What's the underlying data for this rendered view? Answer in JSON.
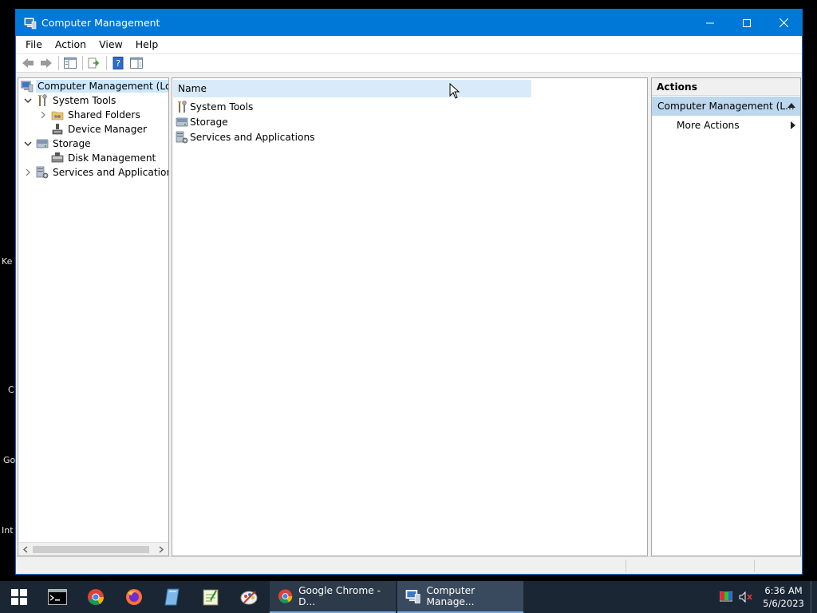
{
  "window": {
    "title": "Computer Management"
  },
  "menu": [
    "File",
    "Action",
    "View",
    "Help"
  ],
  "tree": {
    "root": "Computer Management (Local",
    "items": [
      {
        "label": "System Tools"
      },
      {
        "label": "Shared Folders"
      },
      {
        "label": "Device Manager"
      },
      {
        "label": "Storage"
      },
      {
        "label": "Disk Management"
      },
      {
        "label": "Services and Applications"
      }
    ]
  },
  "list": {
    "column": "Name",
    "rows": [
      "System Tools",
      "Storage",
      "Services and Applications"
    ]
  },
  "actions": {
    "header": "Actions",
    "group": "Computer Management (L...",
    "more": "More Actions"
  },
  "desktop_labels": [
    "Ke",
    "C",
    "Go",
    "Int"
  ],
  "taskbar": {
    "chrome_task": "Google Chrome - D...",
    "mgmt_task": "Computer Manage...",
    "time": "6:36 AM",
    "date": "5/6/2023"
  },
  "colors": {
    "titlebar": "#0078d7",
    "selection": "#cce8ff",
    "taskbar": "#1a2634"
  }
}
